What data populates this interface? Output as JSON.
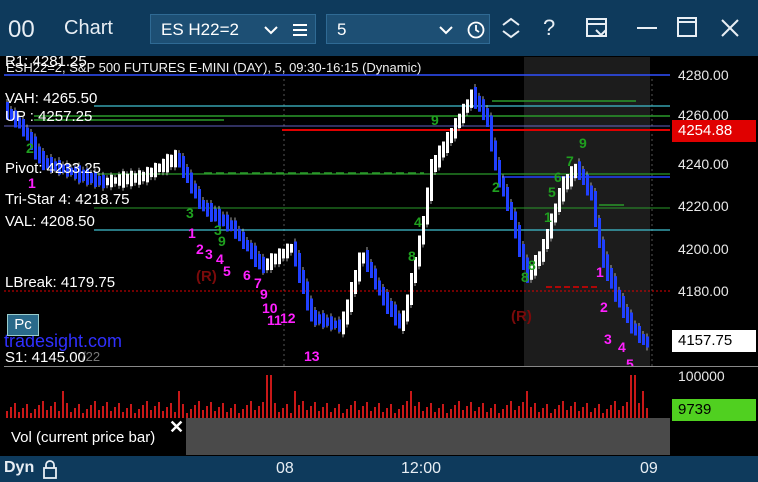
{
  "window": {
    "icon_text": "00",
    "title": "Chart",
    "symbol": "ES H22=2",
    "interval": "5"
  },
  "chart": {
    "header": "ESH22=2, S&P 500 FUTURES E-MINI (DAY), 5, 09:30-16:15 (Dynamic)",
    "levels": {
      "r1": "R1: 4281.25",
      "vah": "VAH: 4265.50",
      "up": "UP : 4257.25",
      "pivot": "Pivot: 4233.25",
      "tristar": "Tri-Star 4: 4218.75",
      "val": "VAL: 4208.50",
      "lbreak": "LBreak: 4179.75",
      "s1": "S1: 4145.00"
    },
    "watermark": "tradesight.com",
    "pc_label": "Pc",
    "faint_text": "/22",
    "price_axis": [
      "4280.00",
      "4260.00",
      "4240.00",
      "4220.00",
      "4200.00",
      "4180.00"
    ],
    "price_marker_red": "4254.88",
    "price_marker_last": "4157.75",
    "r_markers": [
      "(R)",
      "(R)"
    ],
    "td_counts_magenta": [
      "1",
      "1",
      "2",
      "3",
      "4",
      "5",
      "6",
      "7",
      "9",
      "10",
      "11",
      "12",
      "13",
      "1",
      "2",
      "3",
      "4",
      "5"
    ],
    "td_counts_green": [
      "2",
      "3",
      "8",
      "9",
      "9",
      "8",
      "1",
      "2",
      "3",
      "4",
      "5",
      "6",
      "7",
      "8",
      "9"
    ]
  },
  "volume": {
    "axis_top": "100000",
    "current": "9739",
    "label": "Vol (current price bar)"
  },
  "timebar": {
    "mode": "Dyn",
    "labels": [
      "08",
      "12:00",
      "09"
    ]
  },
  "colors": {
    "titlebar": "#0e3a5c",
    "bull": "#ffffff",
    "bear": "#2040ff",
    "red_line": "#e00000",
    "green_line": "#2a9a2a",
    "cyan_line": "#40c0d0",
    "magenta": "#ff20ff",
    "volume_current": "#50d020"
  }
}
